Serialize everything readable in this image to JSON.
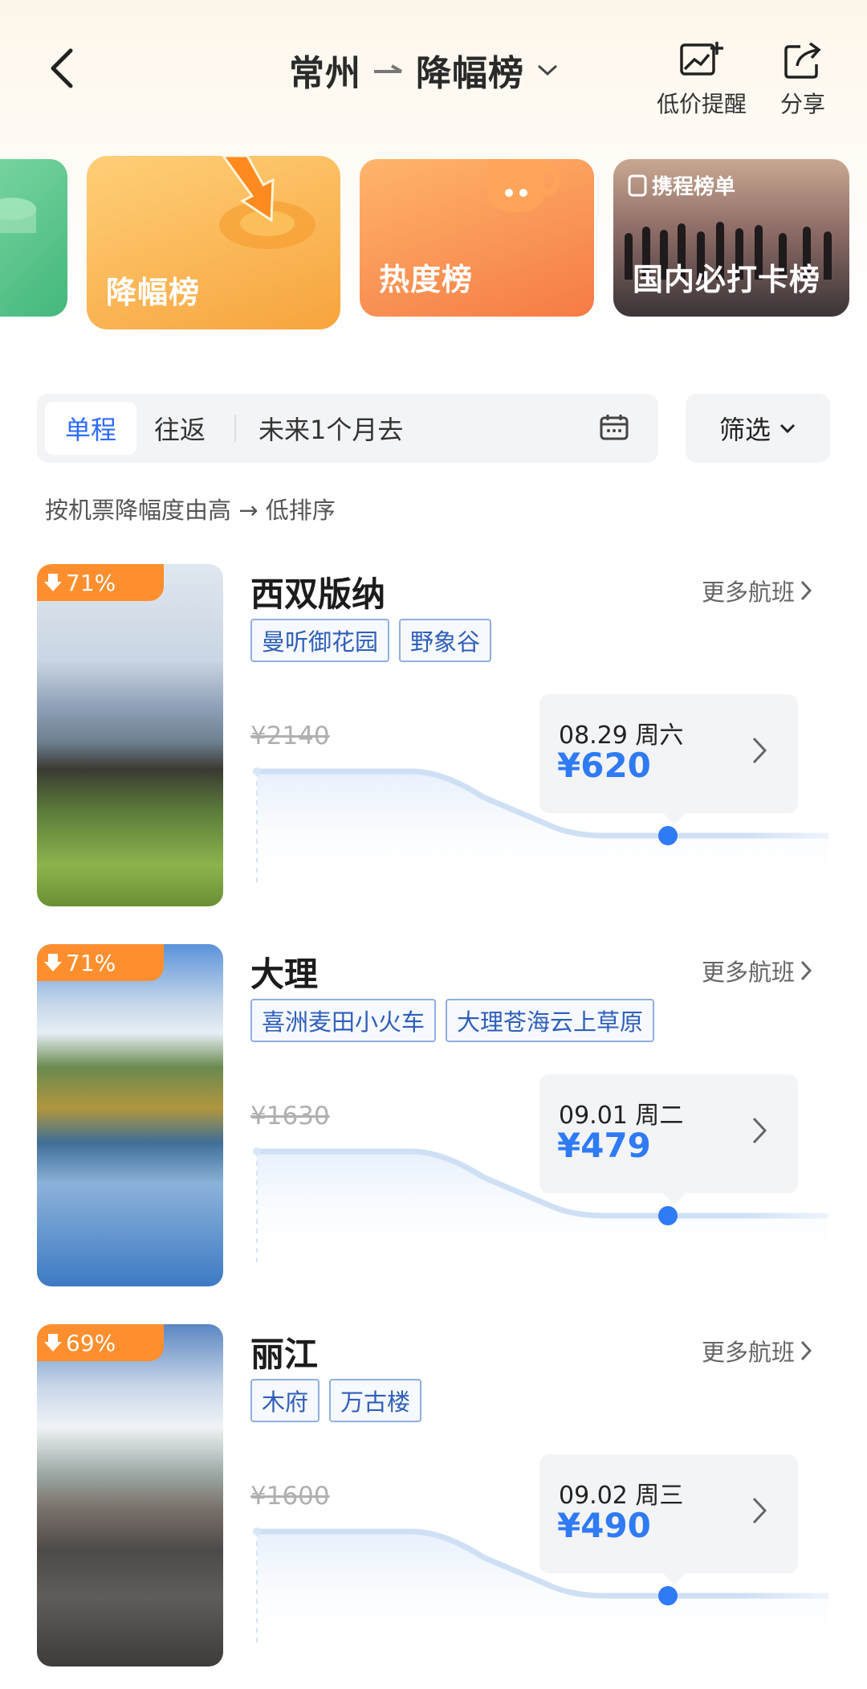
{
  "header": {
    "origin": "常州",
    "board": "降幅榜",
    "actions": [
      {
        "label": "低价提醒",
        "icon": "image-add-icon"
      },
      {
        "label": "分享",
        "icon": "share-icon"
      }
    ]
  },
  "categories": [
    {
      "label": "降幅榜",
      "active": true
    },
    {
      "label": "热度榜"
    },
    {
      "label": "国内必打卡榜",
      "badge": "携程榜单"
    }
  ],
  "filter": {
    "trip_types": [
      "单程",
      "往返"
    ],
    "selected_trip": "单程",
    "date_range": "未来1个月去",
    "screen_label": "筛选"
  },
  "sort_note": "按机票降幅度由高 → 低排序",
  "more_label": "更多航班",
  "destinations": [
    {
      "name": "西双版纳",
      "drop": "71%",
      "tags": [
        "曼听御花园",
        "野象谷"
      ],
      "original_price": "¥2140",
      "date": "08.29 周六",
      "price": "¥620"
    },
    {
      "name": "大理",
      "drop": "71%",
      "tags": [
        "喜洲麦田小火车",
        "大理苍海云上草原"
      ],
      "original_price": "¥1630",
      "date": "09.01 周二",
      "price": "¥479"
    },
    {
      "name": "丽江",
      "drop": "69%",
      "tags": [
        "木府",
        "万古楼"
      ],
      "original_price": "¥1600",
      "date": "09.02 周三",
      "price": "¥490"
    }
  ],
  "colors": {
    "accent": "#2f7af5",
    "drop_badge": "#ff8f2e",
    "tag_border": "#8fb0df"
  }
}
